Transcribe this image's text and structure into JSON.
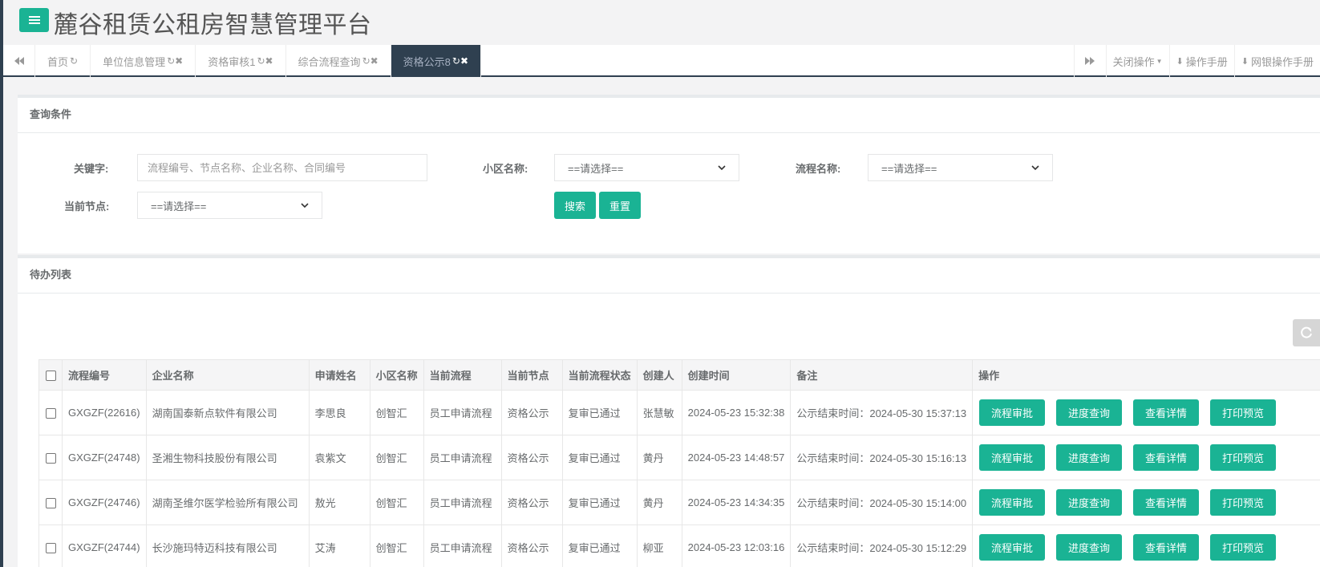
{
  "app": {
    "title": "麓谷租赁公租房智慧管理平台"
  },
  "tabs": [
    {
      "label": "首页",
      "icons": "↻"
    },
    {
      "label": "单位信息管理",
      "icons": "↻✖"
    },
    {
      "label": "资格审核1",
      "icons": "↻✖"
    },
    {
      "label": "综合流程查询",
      "icons": "↻✖"
    },
    {
      "label": "资格公示8",
      "icons": "↻✖"
    }
  ],
  "toolbar": {
    "close_ops": "关闭操作",
    "manual": "操作手册",
    "bank_manual": "网银操作手册"
  },
  "query": {
    "title": "查询条件",
    "keyword_label": "关键字:",
    "keyword_placeholder": "流程编号、节点名称、企业名称、合同编号",
    "community_label": "小区名称:",
    "community_value": "==请选择==",
    "flow_label": "流程名称:",
    "flow_value": "==请选择==",
    "node_label": "当前节点:",
    "node_value": "==请选择==",
    "search_label": "搜索",
    "reset_label": "重置"
  },
  "list": {
    "title": "待办列表",
    "columns": [
      "流程编号",
      "企业名称",
      "申请姓名",
      "小区名称",
      "当前流程",
      "当前节点",
      "当前流程状态",
      "创建人",
      "创建时间",
      "备注",
      "操作"
    ],
    "actions": [
      "流程审批",
      "进度查询",
      "查看详情",
      "打印预览"
    ],
    "rows": [
      [
        "GXGZF(22616)",
        "湖南国泰新点软件有限公司",
        "李思良",
        "创智汇",
        "员工申请流程",
        "资格公示",
        "复审已通过",
        "张慧敏",
        "2024-05-23 15:32:38",
        "公示结束时间：2024-05-30 15:37:13"
      ],
      [
        "GXGZF(24748)",
        "圣湘生物科技股份有限公司",
        "袁紫文",
        "创智汇",
        "员工申请流程",
        "资格公示",
        "复审已通过",
        "黄丹",
        "2024-05-23 14:48:57",
        "公示结束时间：2024-05-30 15:16:13"
      ],
      [
        "GXGZF(24746)",
        "湖南圣维尔医学检验所有限公司",
        "敖光",
        "创智汇",
        "员工申请流程",
        "资格公示",
        "复审已通过",
        "黄丹",
        "2024-05-23 14:34:35",
        "公示结束时间：2024-05-30 15:14:00"
      ],
      [
        "GXGZF(24744)",
        "长沙施玛特迈科技有限公司",
        "艾涛",
        "创智汇",
        "员工申请流程",
        "资格公示",
        "复审已通过",
        "柳亚",
        "2024-05-23 12:03:16",
        "公示结束时间：2024-05-30 15:12:29"
      ]
    ]
  },
  "colors": {
    "accent": "#1ab394",
    "nav_dark": "#2f4050"
  }
}
